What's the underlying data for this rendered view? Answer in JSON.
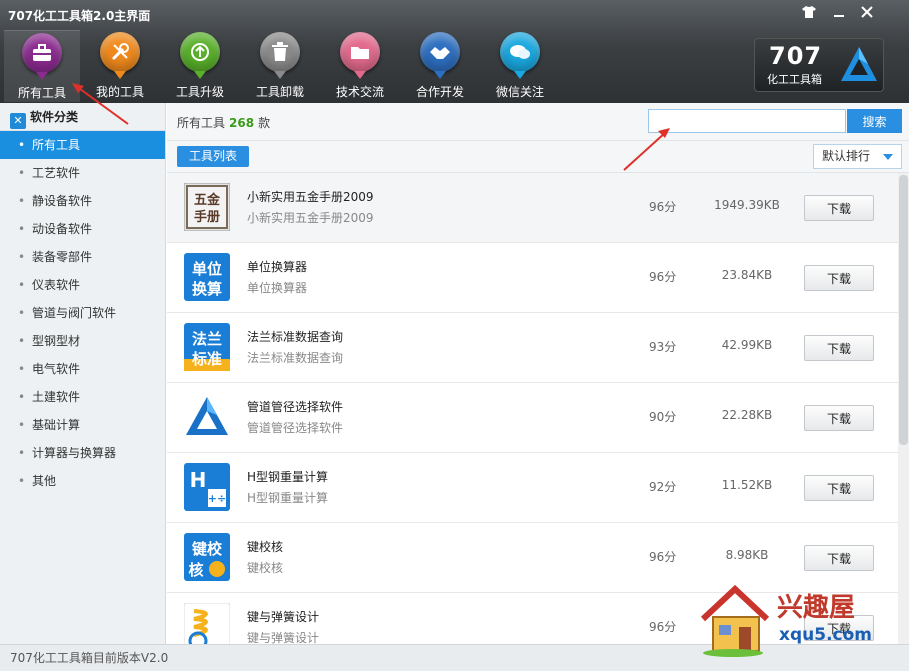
{
  "window": {
    "title": "707化工工具箱2.0主界面",
    "controls": [
      "shirt-icon",
      "minimize-icon",
      "close-icon"
    ]
  },
  "toolbar": [
    {
      "label": "所有工具",
      "icon": "toolbox-icon",
      "color": "#8b2a8f",
      "active": true
    },
    {
      "label": "我的工具",
      "icon": "tools-icon",
      "color": "#f08a1c"
    },
    {
      "label": "工具升级",
      "icon": "upgrade-icon",
      "color": "#59b02a"
    },
    {
      "label": "工具卸载",
      "icon": "trash-icon",
      "color": "#8b8b8b"
    },
    {
      "label": "技术交流",
      "icon": "folder-icon",
      "color": "#e26a8d"
    },
    {
      "label": "合作开发",
      "icon": "handshake-icon",
      "color": "#2d6fc0"
    },
    {
      "label": "微信关注",
      "icon": "chat-icon",
      "color": "#1aa8e0"
    }
  ],
  "brand": {
    "number": "707",
    "name": "化工工具箱"
  },
  "sidebar": {
    "header": "软件分类",
    "items": [
      "所有工具",
      "工艺软件",
      "静设备软件",
      "动设备软件",
      "装备零部件",
      "仪表软件",
      "管道与阀门软件",
      "型钢型材",
      "电气软件",
      "土建软件",
      "基础计算",
      "计算器与换算器",
      "其他"
    ],
    "active_index": 0
  },
  "main": {
    "count_prefix": "所有工具",
    "count": "268",
    "count_suffix": "款",
    "search_placeholder": "",
    "search_button": "搜索",
    "tab_label": "工具列表",
    "sort_label": "默认排行"
  },
  "tools": [
    {
      "name": "小新实用五金手册2009",
      "desc": "小新实用五金手册2009",
      "score": "96分",
      "size": "1949.39KB",
      "button": "下载",
      "icon_text": "五金手册"
    },
    {
      "name": "单位换算器",
      "desc": "单位换算器",
      "score": "96分",
      "size": "23.84KB",
      "button": "下载",
      "icon_text": "单位换算"
    },
    {
      "name": "法兰标准数据查询",
      "desc": "法兰标准数据查询",
      "score": "93分",
      "size": "42.99KB",
      "button": "下载",
      "icon_text": "法兰标准"
    },
    {
      "name": "管道管径选择软件",
      "desc": "管道管径选择软件",
      "score": "90分",
      "size": "22.28KB",
      "button": "下载",
      "icon_text": ""
    },
    {
      "name": "H型钢重量计算",
      "desc": "H型钢重量计算",
      "score": "92分",
      "size": "11.52KB",
      "button": "下载",
      "icon_text": "H"
    },
    {
      "name": "键校核",
      "desc": "键校核",
      "score": "96分",
      "size": "8.98KB",
      "button": "下载",
      "icon_text": "键校核"
    },
    {
      "name": "键与弹簧设计",
      "desc": "键与弹簧设计",
      "score": "96分",
      "size": "",
      "button": "下载",
      "icon_text": ""
    }
  ],
  "status": "707化工工具箱目前版本V2.0",
  "watermark": {
    "text": "兴趣屋",
    "url": "xqu5.com"
  }
}
